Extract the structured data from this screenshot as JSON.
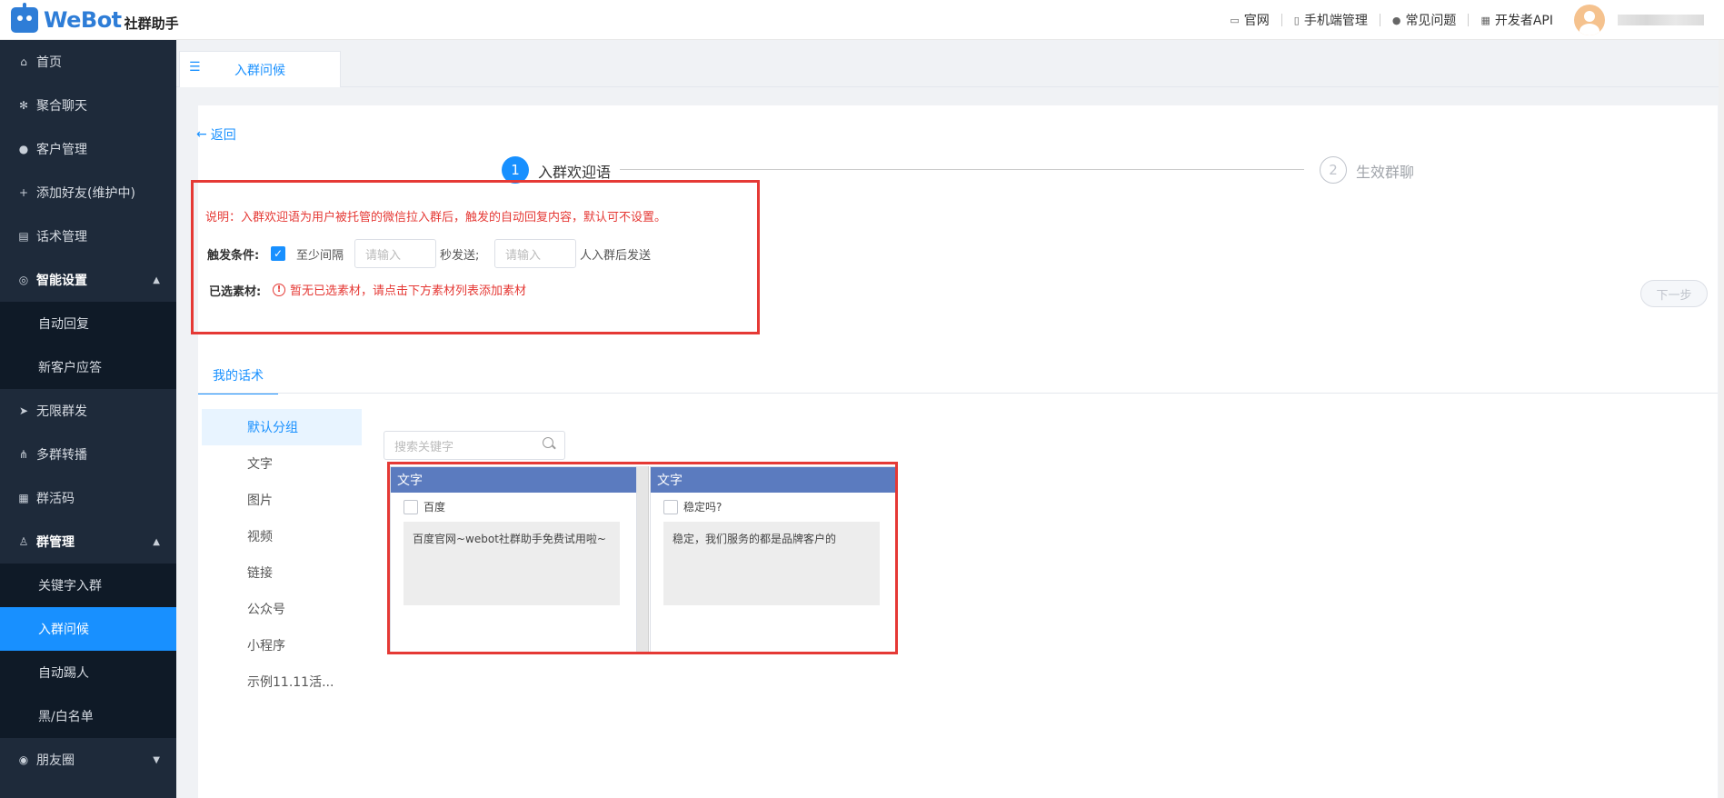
{
  "header": {
    "logo_text": "WeBot",
    "logo_sub": "社群助手",
    "nav": [
      {
        "label": "官网",
        "icon": "monitor-icon"
      },
      {
        "label": "手机端管理",
        "icon": "phone-icon"
      },
      {
        "label": "常见问题",
        "icon": "question-icon"
      },
      {
        "label": "开发者API",
        "icon": "api-icon"
      }
    ]
  },
  "sidebar": {
    "items": [
      {
        "label": "首页",
        "icon": "home-icon"
      },
      {
        "label": "聚合聊天",
        "icon": "gear-icon"
      },
      {
        "label": "客户管理",
        "icon": "user-icon"
      },
      {
        "label": "添加好友(维护中)",
        "icon": "add-user-icon"
      },
      {
        "label": "话术管理",
        "icon": "document-icon"
      },
      {
        "label": "智能设置",
        "icon": "smart-icon"
      },
      {
        "label": "无限群发",
        "icon": "send-icon"
      },
      {
        "label": "多群转播",
        "icon": "broadcast-icon"
      },
      {
        "label": "群活码",
        "icon": "qrcode-icon"
      },
      {
        "label": "群管理",
        "icon": "group-icon"
      },
      {
        "label": "朋友圈",
        "icon": "moments-icon"
      }
    ],
    "smart_sub": [
      "自动回复",
      "新客户应答"
    ],
    "group_sub": [
      "关键字入群",
      "入群问候",
      "自动踢人",
      "黑/白名单"
    ]
  },
  "tab": {
    "label": "入群问候"
  },
  "back": "返回",
  "steps": [
    {
      "num": "1",
      "label": "入群欢迎语"
    },
    {
      "num": "2",
      "label": "生效群聊"
    }
  ],
  "form": {
    "description": "说明：入群欢迎语为用户被托管的微信拉入群后，触发的自动回复内容，默认可不设置。",
    "trigger_label": "触发条件:",
    "interval_text": "至少间隔",
    "interval_placeholder": "请输入",
    "seconds_text": "秒发送;",
    "count_placeholder": "请输入",
    "count_text": "人入群后发送",
    "selected_label": "已选素材:",
    "selected_warning": "暂无已选素材，请点击下方素材列表添加素材"
  },
  "next_button": "下一步",
  "my_scripts_tab": "我的话术",
  "categories": [
    "默认分组",
    "文字",
    "图片",
    "视频",
    "链接",
    "公众号",
    "小程序",
    "示例11.11活..."
  ],
  "search_placeholder": "搜索关键字",
  "cards": [
    {
      "type": "文字",
      "title": "百度",
      "content": "百度官网~webot社群助手免费试用啦~"
    },
    {
      "type": "文字",
      "title": "稳定吗?",
      "content": "稳定，我们服务的都是品牌客户的"
    }
  ]
}
